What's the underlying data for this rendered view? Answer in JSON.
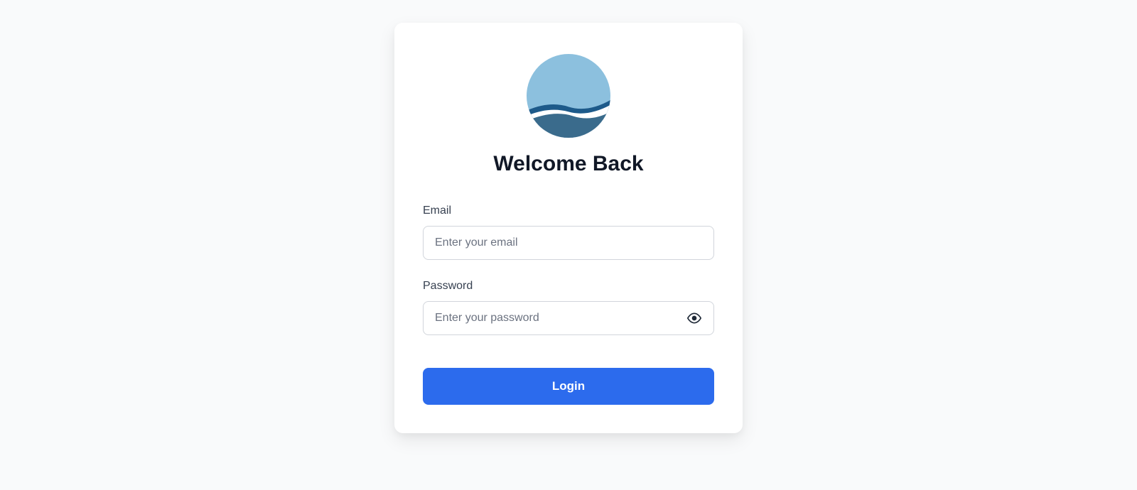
{
  "title": "Welcome Back",
  "form": {
    "email": {
      "label": "Email",
      "placeholder": "Enter your email",
      "value": ""
    },
    "password": {
      "label": "Password",
      "placeholder": "Enter your password",
      "value": ""
    },
    "login_button": "Login"
  },
  "colors": {
    "background": "#f9fafb",
    "card": "#ffffff",
    "primary": "#2c6bed",
    "text": "#111827",
    "label": "#374151",
    "placeholder": "#6b7280",
    "border": "#d1d5db"
  }
}
